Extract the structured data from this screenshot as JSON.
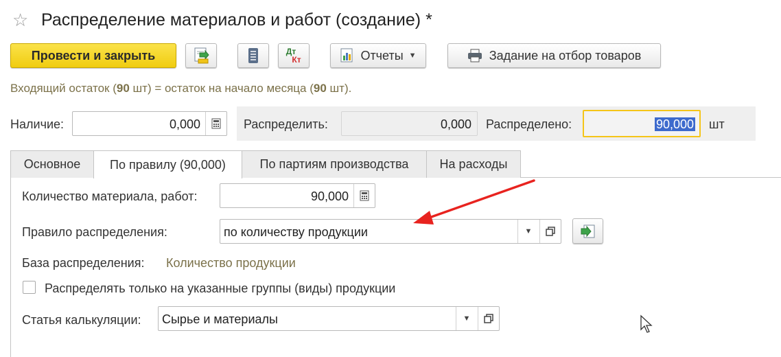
{
  "window": {
    "title": "Распределение материалов и работ (создание) *"
  },
  "toolbar": {
    "post_close_label": "Провести и закрыть",
    "reports_label": "Отчеты",
    "goods_selection_label": "Задание на отбор товаров",
    "dt_kt_top": "Дт",
    "dt_kt_bottom": "Кт"
  },
  "info": {
    "prefix": "Входящий остаток (",
    "qty1": "90",
    "middle": " шт) = остаток на начало месяца (",
    "qty2": "90",
    "suffix": " шт)."
  },
  "availability": {
    "label": "Наличие:",
    "value": "0,000"
  },
  "to_distribute": {
    "label": "Распределить:",
    "value": "0,000"
  },
  "distributed": {
    "label": "Распределено:",
    "value": "90,000",
    "unit": "шт"
  },
  "tabs": [
    {
      "label": "Основное",
      "active": false
    },
    {
      "label": "По правилу (90,000)",
      "active": true
    },
    {
      "label": "По партиям производства",
      "active": false
    },
    {
      "label": "На расходы",
      "active": false
    }
  ],
  "form": {
    "quantity_label": "Количество материала, работ:",
    "quantity_value": "90,000",
    "rule_label": "Правило распределения:",
    "rule_value": "по количеству продукции",
    "base_label": "База распределения:",
    "base_value": "Количество продукции",
    "groups_checkbox_label": "Распределять только на указанные группы (виды) продукции",
    "groups_checkbox_checked": false,
    "cost_item_label": "Статья калькуляции:",
    "cost_item_value": "Сырье и материалы"
  },
  "colors": {
    "primary_button": "#f5d327",
    "focus_border": "#f5c518",
    "selection": "#3d6acd",
    "annotation_arrow": "#e8231f",
    "info_text": "#7b7149"
  }
}
